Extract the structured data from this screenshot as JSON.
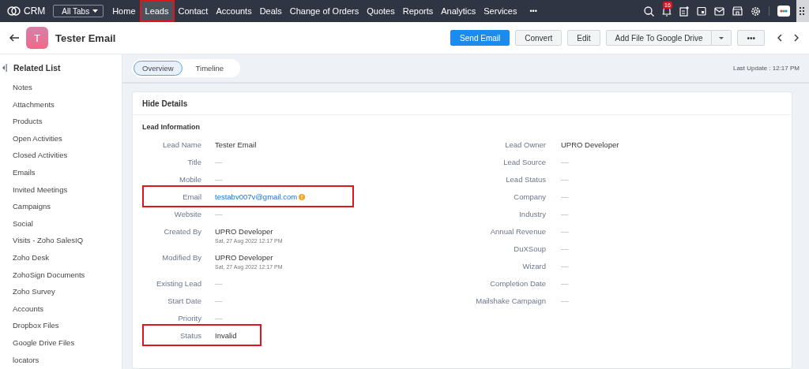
{
  "topbar": {
    "logo": "CRM",
    "all_tabs": "All Tabs",
    "nav": [
      {
        "label": "Home",
        "selected": false,
        "highlighted": false
      },
      {
        "label": "Leads",
        "selected": true,
        "highlighted": true
      },
      {
        "label": "Contact",
        "selected": false,
        "highlighted": false
      },
      {
        "label": "Accounts",
        "selected": false,
        "highlighted": false
      },
      {
        "label": "Deals",
        "selected": false,
        "highlighted": false
      },
      {
        "label": "Change of Orders",
        "selected": false,
        "highlighted": false
      },
      {
        "label": "Quotes",
        "selected": false,
        "highlighted": false
      },
      {
        "label": "Reports",
        "selected": false,
        "highlighted": false
      },
      {
        "label": "Analytics",
        "selected": false,
        "highlighted": false
      },
      {
        "label": "Services",
        "selected": false,
        "highlighted": false
      }
    ],
    "more": "•••",
    "notification_count": "16"
  },
  "record": {
    "avatar_letter": "T",
    "name": "Tester Email",
    "buttons": [
      {
        "label": "Send Email",
        "kind": "primary"
      },
      {
        "label": "Convert",
        "kind": "plain"
      },
      {
        "label": "Edit",
        "kind": "plain"
      },
      {
        "label": "Add File To Google Drive",
        "kind": "split"
      },
      {
        "label": "•••",
        "kind": "plain"
      }
    ]
  },
  "sidebar": {
    "title": "Related List",
    "items": [
      "Notes",
      "Attachments",
      "Products",
      "Open Activities",
      "Closed Activities",
      "Emails",
      "Invited Meetings",
      "Campaigns",
      "Social",
      "Visits - Zoho SalesIQ",
      "Zoho Desk",
      "ZohoSign Documents",
      "Zoho Survey",
      "Accounts",
      "Dropbox Files",
      "Google Drive Files",
      "locators"
    ]
  },
  "view_tabs": [
    {
      "label": "Overview",
      "selected": true
    },
    {
      "label": "Timeline",
      "selected": false
    }
  ],
  "last_update": "Last Update : 12:17 PM",
  "details": {
    "toggle": "Hide Details",
    "section": "Lead Information",
    "left": [
      {
        "label": "Lead Name",
        "value": "Tester Email",
        "kind": "text",
        "highlighted": false
      },
      {
        "label": "Title",
        "value": "—",
        "kind": "empty",
        "highlighted": false
      },
      {
        "label": "Mobile",
        "value": "—",
        "kind": "empty",
        "highlighted": false
      },
      {
        "label": "Email",
        "value": "testabv007v@gmail.com",
        "kind": "link",
        "highlighted": true,
        "warning": true
      },
      {
        "label": "Website",
        "value": "—",
        "kind": "empty",
        "highlighted": false
      },
      {
        "label": "Created By",
        "value": "UPRO Developer",
        "sub": "Sat, 27 Aug 2022 12:17 PM",
        "kind": "text",
        "highlighted": false
      },
      {
        "label": "Modified By",
        "value": "UPRO Developer",
        "sub": "Sat, 27 Aug 2022 12:17 PM",
        "kind": "text",
        "highlighted": false
      },
      {
        "label": "Existing Lead",
        "value": "—",
        "kind": "empty",
        "highlighted": false
      },
      {
        "label": "Start Date",
        "value": "—",
        "kind": "empty",
        "highlighted": false
      },
      {
        "label": "Priority",
        "value": "—",
        "kind": "empty",
        "highlighted": false
      },
      {
        "label": "Status",
        "value": "Invalid",
        "kind": "text",
        "highlighted": true
      }
    ],
    "right": [
      {
        "label": "Lead Owner",
        "value": "UPRO Developer",
        "kind": "text",
        "highlighted": false
      },
      {
        "label": "Lead Source",
        "value": "—",
        "kind": "empty",
        "highlighted": false
      },
      {
        "label": "Lead Status",
        "value": "—",
        "kind": "empty",
        "highlighted": false
      },
      {
        "label": "Company",
        "value": "—",
        "kind": "empty",
        "highlighted": false
      },
      {
        "label": "Industry",
        "value": "—",
        "kind": "empty",
        "highlighted": false
      },
      {
        "label": "Annual Revenue",
        "value": "—",
        "kind": "empty",
        "highlighted": false
      },
      {
        "label": "DuXSoup",
        "value": "—",
        "kind": "empty",
        "highlighted": false
      },
      {
        "label": "Wizard",
        "value": "—",
        "kind": "empty",
        "highlighted": false
      },
      {
        "label": "Completion Date",
        "value": "—",
        "kind": "empty",
        "highlighted": false
      },
      {
        "label": "Mailshake Campaign",
        "value": "—",
        "kind": "empty",
        "highlighted": false
      }
    ]
  }
}
